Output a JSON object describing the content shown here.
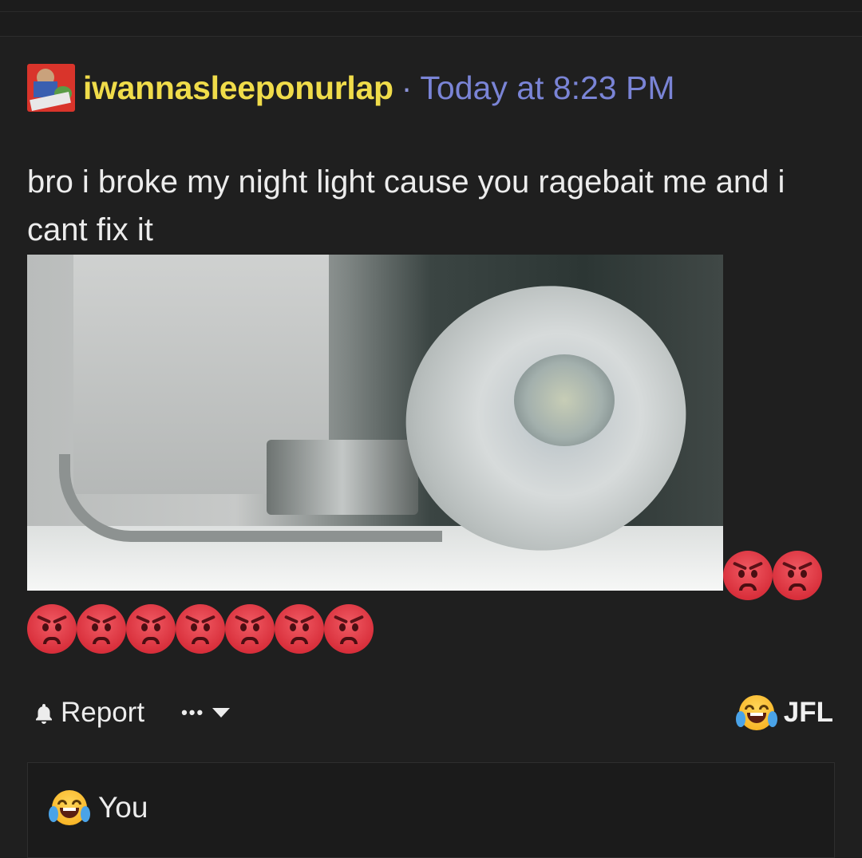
{
  "post": {
    "username": "iwannasleeponurlap",
    "separator": "·",
    "timestamp": "Today at 8:23 PM",
    "message": "bro i broke my night light cause you ragebait me and i cant fix it",
    "emoji_after_image": [
      "angry-face",
      "angry-face"
    ],
    "emoji_row": [
      "angry-face",
      "angry-face",
      "angry-face",
      "angry-face",
      "angry-face",
      "angry-face",
      "angry-face"
    ]
  },
  "actions": {
    "report_label": "Report",
    "more_label": "•••",
    "reaction_emoji": "face-with-tears-of-joy",
    "reaction_label": "JFL"
  },
  "reply": {
    "emoji": "face-with-tears-of-joy",
    "author": "You"
  },
  "colors": {
    "background": "#1f1f1f",
    "username": "#f0dc4a",
    "timestamp": "#7a84d6",
    "text": "#ececec"
  }
}
